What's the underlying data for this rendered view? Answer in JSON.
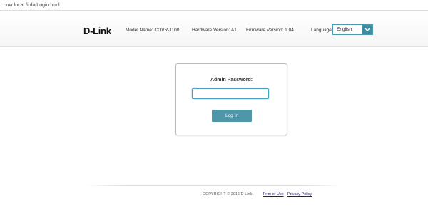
{
  "browser": {
    "url": "covr.local./info/Login.html"
  },
  "header": {
    "logo": "D-Link",
    "model_name": "Model Name: COVR-1100",
    "hardware_version": "Hardware Version: A1",
    "firmware_version": "Firmware Version: 1.04",
    "language_label": "Language:",
    "language_value": "English"
  },
  "login": {
    "password_label": "Admin Password:",
    "password_value": "",
    "login_label": "Log In"
  },
  "footer": {
    "copyright": "COPYRIGHT © 2016 D-Link",
    "terms_label": "Term of Use",
    "privacy_label": "Privacy Policy"
  },
  "colors": {
    "accent": "#4e97a8",
    "input_focus": "#4aa3c4",
    "link": "#1a1a8c"
  }
}
